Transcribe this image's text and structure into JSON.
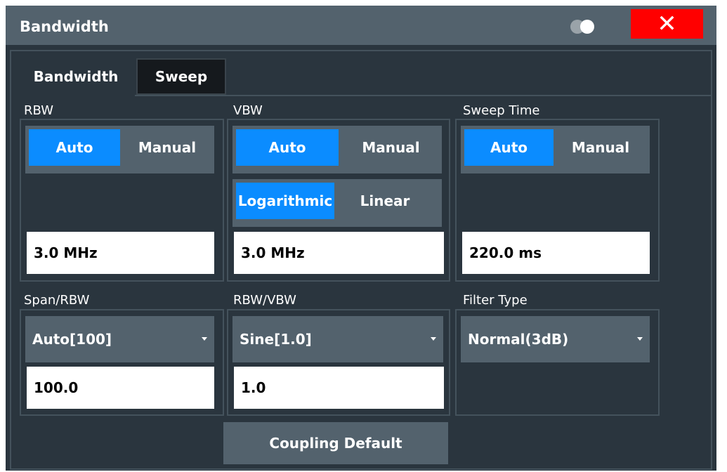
{
  "window": {
    "title": "Bandwidth",
    "close_label": "✕"
  },
  "tabs": [
    {
      "label": "Bandwidth",
      "active": true
    },
    {
      "label": "Sweep",
      "active": false
    }
  ],
  "rbw": {
    "label": "RBW",
    "options": [
      "Auto",
      "Manual"
    ],
    "selected": "Auto",
    "value": "3.0 MHz"
  },
  "vbw": {
    "label": "VBW",
    "options": [
      "Auto",
      "Manual"
    ],
    "selected": "Auto",
    "mode_options": [
      "Logarithmic",
      "Linear"
    ],
    "mode_selected": "Logarithmic",
    "value": "3.0 MHz"
  },
  "sweep_time": {
    "label": "Sweep Time",
    "options": [
      "Auto",
      "Manual"
    ],
    "selected": "Auto",
    "value": "220.0 ms"
  },
  "span_rbw": {
    "label": "Span/RBW",
    "selected": "Auto[100]",
    "value": "100.0"
  },
  "rbw_vbw": {
    "label": "RBW/VBW",
    "selected": "Sine[1.0]",
    "value": "1.0"
  },
  "filter_type": {
    "label": "Filter Type",
    "selected": "Normal(3dB)"
  },
  "coupling_default_label": "Coupling Default",
  "colors": {
    "accent": "#0b8cff",
    "background": "#2a353e",
    "control": "#53626d",
    "close": "#ff0000"
  },
  "icons": {
    "toggle": "toggle-icon",
    "close": "close-icon",
    "dropdown": "caret-down-icon"
  }
}
